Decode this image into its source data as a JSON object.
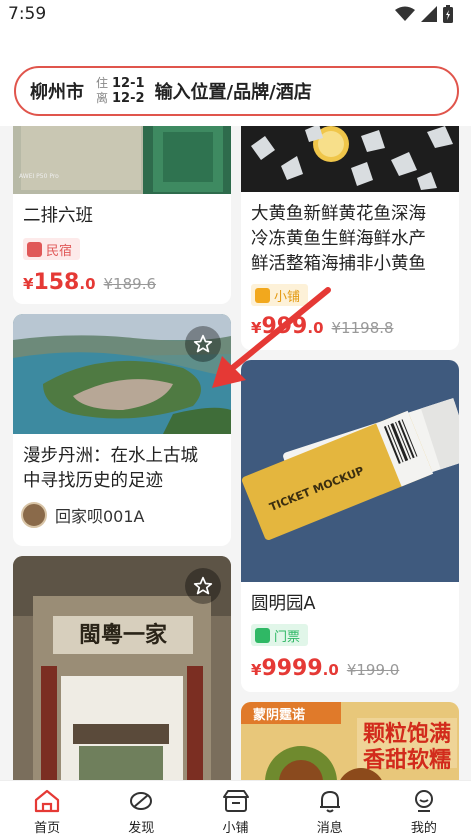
{
  "status": {
    "time": "7:59"
  },
  "search": {
    "city": "柳州市",
    "checkin_tag": "住",
    "checkin_date": "12-1",
    "checkout_tag": "离",
    "checkout_date": "12-2",
    "placeholder": "输入位置/品牌/酒店"
  },
  "cards": {
    "homestay": {
      "title": "二排六班",
      "badge": "民宿",
      "price_currency": "¥",
      "price_int": "158",
      "price_dec": ".0",
      "orig": "¥189.6"
    },
    "fish": {
      "title_1": "大黄鱼新鲜黄花鱼深海",
      "title_2": "冷冻黄鱼生鲜海鲜水产",
      "title_3": "鲜活整箱海捕非小黄鱼",
      "badge": "小铺",
      "price_currency": "¥",
      "price_int": "999",
      "price_dec": ".0",
      "orig": "¥1198.8"
    },
    "article": {
      "title_1": "漫步丹洲：在水上古城",
      "title_2": "中寻找历史的足迹",
      "author": "回家呗001A"
    },
    "ticket": {
      "title": "圆明园A",
      "badge": "门票",
      "price_currency": "¥",
      "price_int": "9999",
      "price_dec": ".0",
      "orig": "¥199.0",
      "mock_text": "TICKET MOCKUP"
    },
    "oldhouse": {
      "plaque": "閩粵一家"
    },
    "chestnut": {
      "brand": "蒙阴霆诺",
      "slogan_1": "颗粒饱满",
      "slogan_2": "香甜软糯"
    }
  },
  "nav": {
    "items": [
      {
        "label": "首页",
        "icon": "home-icon",
        "active": true
      },
      {
        "label": "发现",
        "icon": "leaf-icon",
        "active": false
      },
      {
        "label": "小铺",
        "icon": "shop-icon",
        "active": false
      },
      {
        "label": "消息",
        "icon": "bell-icon",
        "active": false
      },
      {
        "label": "我的",
        "icon": "profile-icon",
        "active": false
      }
    ]
  },
  "colors": {
    "accent": "#e53935",
    "homestay_badge": "#e05858",
    "shop_badge": "#f2a81d",
    "ticket_badge": "#2fb865"
  }
}
